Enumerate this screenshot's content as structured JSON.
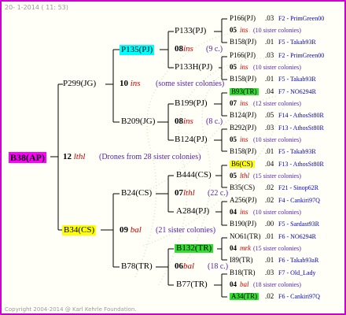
{
  "header": {
    "date": "20-  1-2014 ( 11: 53)"
  },
  "footer": {
    "copyright": "Copyright 2004-2014 @ Karl Kehrle Foundation."
  },
  "root": {
    "label": "B38(AP)"
  },
  "level1": [
    {
      "label": "P299(JG)",
      "gen_num": "10",
      "gen_ins": "ins",
      "note": "(some sister colonies)"
    },
    {
      "label": "B34(CS)",
      "gen_num": "09",
      "gen_ins": "bal",
      "note": "(21 sister colonies)"
    }
  ],
  "root_gen": {
    "num": "12",
    "ins": "lthl",
    "note": "(Drones from 28 sister colonies)"
  },
  "level2": [
    {
      "label": "P135(PJ)",
      "gen_num": "08",
      "gen_ins": "ins",
      "note": "(9 c.)"
    },
    {
      "label": "B209(JG)",
      "gen_num": "08",
      "gen_ins": "ins",
      "note": "(8 c.)"
    },
    {
      "label": "B24(CS)",
      "gen_num": "07",
      "gen_ins": "lthl",
      "note": "(22 c.)"
    },
    {
      "label": "B78(TR)",
      "gen_num": "06",
      "gen_ins": "bal",
      "note": "(18 c.)"
    }
  ],
  "level3": [
    {
      "label": "P133(PJ)"
    },
    {
      "label": "P133H(PJ)"
    },
    {
      "label": "B199(PJ)"
    },
    {
      "label": "B124(PJ)"
    },
    {
      "label": "B444(CS)"
    },
    {
      "label": "A284(PJ)"
    },
    {
      "label": "B132(TR)"
    },
    {
      "label": "B77(TR)"
    }
  ],
  "level4": [
    {
      "top": "P166(PJ)",
      "top_val": ".03",
      "top_info": "F2 - PrimGreen00",
      "gen_num": "05",
      "gen_ins": "ins",
      "note": "(10 sister colonies)",
      "bottom": "B158(PJ)",
      "bottom_val": ".01",
      "bottom_info": "F5 - Takab93R"
    },
    {
      "top": "P166(PJ)",
      "top_val": ".03",
      "top_info": "F2 - PrimGreen00",
      "gen_num": "05",
      "gen_ins": "ins",
      "note": "(10 sister colonies)",
      "bottom": "B158(PJ)",
      "bottom_val": ".01",
      "bottom_info": "F5 - Takab93R"
    },
    {
      "top": "B93(TR)",
      "top_val": ".04",
      "top_info": "F7 - NO6294R",
      "gen_num": "07",
      "gen_ins": "ins",
      "note": "(12 sister colonies)",
      "bottom": "B124(PJ)",
      "bottom_val": ".05",
      "bottom_info": "F14 - AthosSt80R"
    },
    {
      "top": "B292(PJ)",
      "top_val": ".03",
      "top_info": "F13 - AthosSt80R",
      "gen_num": "05",
      "gen_ins": "ins",
      "note": "(10 sister colonies)",
      "bottom": "B158(PJ)",
      "bottom_val": ".01",
      "bottom_info": "F5 - Takab93R"
    },
    {
      "top": "B6(CS)",
      "top_val": ".04",
      "top_info": "F13 - AthosSt80R",
      "gen_num": "05",
      "gen_ins": "lthl",
      "note": "(15 sister colonies)",
      "bottom": "B35(CS)",
      "bottom_val": ".02",
      "bottom_info": "F21 - Sinop62R"
    },
    {
      "top": "A256(PJ)",
      "top_val": ".02",
      "top_info": "F4 - Cankiri97Q",
      "gen_num": "04",
      "gen_ins": "ins",
      "note": "(10 sister colonies)",
      "bottom": "B190(PJ)",
      "bottom_val": ".00",
      "bottom_info": "F5 - Sardast93R"
    },
    {
      "top": "NO61(TR)",
      "top_val": ".01",
      "top_info": "F6 - NO6294R",
      "gen_num": "04",
      "gen_ins": "mrk",
      "note": "(15 sister colonies)",
      "bottom": "I89(TR)",
      "bottom_val": ".01",
      "bottom_info": "F6 - Takab93aR"
    },
    {
      "top": "B18(TR)",
      "top_val": ".03",
      "top_info": "F7 - Old_Lady",
      "gen_num": "04",
      "gen_ins": "bal",
      "note": "(18 sister colonies)",
      "bottom": "A34(TR)",
      "bottom_val": ".02",
      "bottom_info": "F6 - Cankiri97Q"
    }
  ]
}
